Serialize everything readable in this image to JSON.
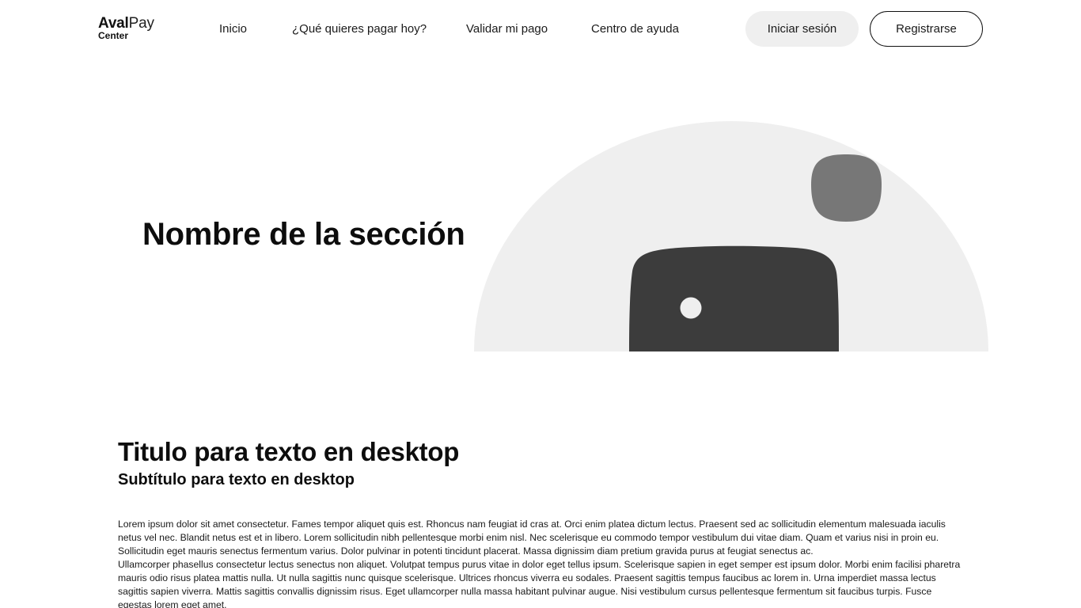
{
  "header": {
    "logo": {
      "word1": "Aval",
      "word2": "Pay",
      "word3": "Center"
    },
    "nav": [
      {
        "label": "Inicio"
      },
      {
        "label": "¿Qué quieres pagar hoy?"
      },
      {
        "label": "Validar mi pago"
      },
      {
        "label": "Centro de ayuda"
      }
    ],
    "login_label": "Iniciar sesión",
    "register_label": "Registrarse"
  },
  "hero": {
    "title": "Nombre de la sección",
    "illustration": "image-placeholder-icon",
    "colors": {
      "background": "#efefef",
      "small_shape": "#777777",
      "large_shape": "#3c3c3c",
      "dot": "#efefef"
    }
  },
  "content": {
    "title": "Titulo para texto en desktop",
    "subtitle": "Subtítulo para texto en desktop",
    "paragraphs": [
      "Lorem ipsum dolor sit amet consectetur. Fames tempor aliquet quis est. Rhoncus nam feugiat id cras at. Orci enim platea dictum lectus. Praesent sed ac sollicitudin elementum malesuada iaculis netus vel nec. Blandit netus est et in libero. Lorem sollicitudin nibh pellentesque morbi enim nisl. Nec scelerisque eu commodo tempor vestibulum dui vitae diam. Quam et varius nisi in proin eu. Sollicitudin eget mauris senectus fermentum varius. Dolor pulvinar in potenti tincidunt placerat. Massa dignissim diam pretium gravida purus at feugiat senectus ac.",
      "Ullamcorper phasellus consectetur lectus senectus non aliquet. Volutpat tempus purus vitae in dolor eget tellus ipsum. Scelerisque sapien in eget semper est ipsum dolor. Morbi enim facilisi pharetra mauris odio risus platea mattis nulla. Ut nulla sagittis nunc quisque scelerisque. Ultrices rhoncus viverra eu sodales. Praesent sagittis tempus faucibus ac lorem in. Urna imperdiet massa lectus sagittis sapien viverra. Mattis sagittis convallis dignissim risus. Eget ullamcorper nulla massa habitant pulvinar augue. Nisi vestibulum cursus pellentesque fermentum sit faucibus turpis. Fusce egestas lorem eget amet."
    ]
  }
}
